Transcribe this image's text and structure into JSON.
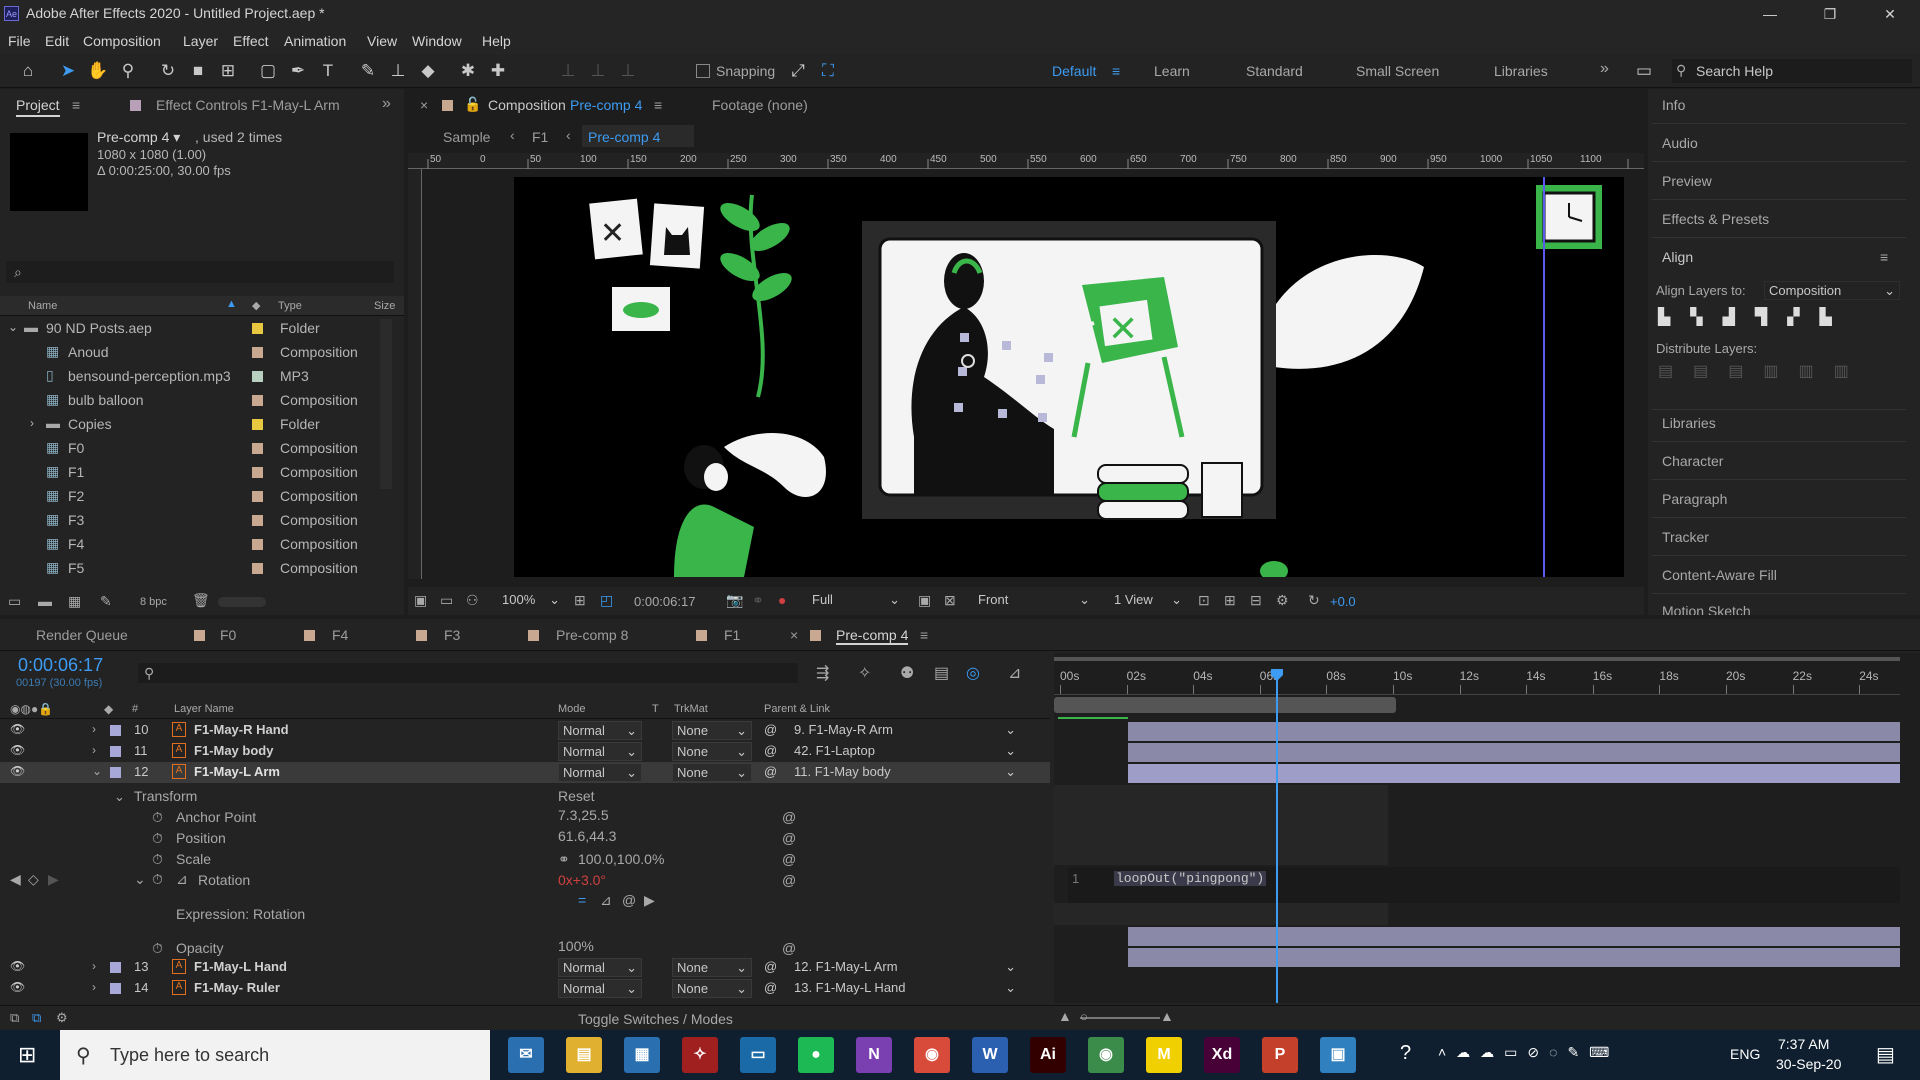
{
  "window": {
    "title": "Adobe After Effects 2020 - Untitled Project.aep *",
    "logo": "Ae",
    "min": "—",
    "max": "❐",
    "close": "✕"
  },
  "menu": [
    "File",
    "Edit",
    "Composition",
    "Layer",
    "Effect",
    "Animation",
    "View",
    "Window",
    "Help"
  ],
  "toolbar": {
    "snapping": "Snapping",
    "workspaces": [
      "Default",
      "Learn",
      "Standard",
      "Small Screen",
      "Libraries"
    ],
    "more": "»",
    "search_placeholder": "Search Help"
  },
  "project_panel": {
    "tab": "Project",
    "tab2": "Effect Controls F1-May-L Arm",
    "comp_name": "Pre-comp 4 ▾",
    "used": ", used 2 times",
    "dims": "1080 x 1080 (1.00)",
    "duration": "Δ 0:00:25:00, 30.00 fps",
    "search_placeholder": "⌕",
    "columns": [
      "Name",
      "Type",
      "Size"
    ],
    "items": [
      {
        "name": "90 ND Posts.aep",
        "type": "Folder",
        "color": "#e8c840",
        "icon": "folder"
      },
      {
        "name": "Anoud",
        "type": "Composition",
        "color": "#c8a890",
        "icon": "comp"
      },
      {
        "name": "bensound-perception.mp3",
        "type": "MP3",
        "color": "#b8d0c0",
        "icon": "file"
      },
      {
        "name": "bulb balloon",
        "type": "Composition",
        "color": "#c8a890",
        "icon": "comp"
      },
      {
        "name": "Copies",
        "type": "Folder",
        "color": "#e8c840",
        "icon": "folder"
      },
      {
        "name": "F0",
        "type": "Composition",
        "color": "#c8a890",
        "icon": "comp"
      },
      {
        "name": "F1",
        "type": "Composition",
        "color": "#c8a890",
        "icon": "comp"
      },
      {
        "name": "F2",
        "type": "Composition",
        "color": "#c8a890",
        "icon": "comp"
      },
      {
        "name": "F3",
        "type": "Composition",
        "color": "#c8a890",
        "icon": "comp"
      },
      {
        "name": "F4",
        "type": "Composition",
        "color": "#c8a890",
        "icon": "comp"
      },
      {
        "name": "F5",
        "type": "Composition",
        "color": "#c8a890",
        "icon": "comp"
      }
    ],
    "bpc": "8 bpc"
  },
  "comp_panel": {
    "tab": "Composition",
    "tab_name": "Pre-comp 4",
    "footage": "Footage (none)",
    "breadcrumbs": [
      "Sample",
      "F1",
      "Pre-comp 4"
    ],
    "ruler": [
      "50",
      "0",
      "50",
      "100",
      "150",
      "200",
      "250",
      "300",
      "350",
      "400",
      "450",
      "500",
      "550",
      "600",
      "650",
      "700",
      "750",
      "800",
      "850",
      "900",
      "950",
      "1000",
      "1050",
      "1100"
    ],
    "zoom": "100%",
    "time": "0:00:06:17",
    "resolution": "Full",
    "view": "Front",
    "views": "1 View",
    "exposure": "+0.0"
  },
  "right_panel": {
    "items": [
      "Info",
      "Audio",
      "Preview",
      "Effects & Presets",
      "Align"
    ],
    "align_to_label": "Align Layers to:",
    "align_to_value": "Composition",
    "distribute": "Distribute Layers:",
    "items2": [
      "Libraries",
      "Character",
      "Paragraph",
      "Tracker",
      "Content-Aware Fill",
      "Motion Sketch"
    ]
  },
  "timeline": {
    "tabs": [
      "Render Queue",
      "F0",
      "F4",
      "F3",
      "Pre-comp 8",
      "F1",
      "Pre-comp 4"
    ],
    "tab_colors": [
      "",
      "#c8a890",
      "#c8a890",
      "#c8a890",
      "#c8a890",
      "#c8a890",
      "#c8a890"
    ],
    "time": "0:00:06:17",
    "frames": "00197 (30.00 fps)",
    "columns": {
      "num": "#",
      "layer": "Layer Name",
      "mode": "Mode",
      "t": "T",
      "trk": "TrkMat",
      "parent": "Parent & Link"
    },
    "layers": [
      {
        "num": "10",
        "name": "F1-May-R Hand",
        "mode": "Normal",
        "trk": "None",
        "parent": "9. F1-May-R Arm"
      },
      {
        "num": "11",
        "name": "F1-May body",
        "mode": "Normal",
        "trk": "None",
        "parent": "42. F1-Laptop"
      },
      {
        "num": "12",
        "name": "F1-May-L Arm",
        "mode": "Normal",
        "trk": "None",
        "parent": "11. F1-May body"
      }
    ],
    "transform": "Transform",
    "reset": "Reset",
    "props": [
      {
        "name": "Anchor Point",
        "value": "7.3,25.5"
      },
      {
        "name": "Position",
        "value": "61.6,44.3"
      },
      {
        "name": "Scale",
        "value": "100.0,100.0%"
      },
      {
        "name": "Rotation",
        "value": "0x+3.0°"
      }
    ],
    "expression_label": "Expression: Rotation",
    "opacity_label": "Opacity",
    "opacity_value": "100%",
    "layers2": [
      {
        "num": "13",
        "name": "F1-May-L Hand",
        "mode": "Normal",
        "trk": "None",
        "parent": "12. F1-May-L Arm"
      },
      {
        "num": "14",
        "name": "F1-May- Ruler",
        "mode": "Normal",
        "trk": "None",
        "parent": "13. F1-May-L Hand"
      }
    ],
    "ruler": [
      "00s",
      "02s",
      "04s",
      "06s",
      "08s",
      "10s",
      "12s",
      "14s",
      "16s",
      "18s",
      "20s",
      "22s",
      "24s"
    ],
    "expr_line": "1",
    "expression": "loopOut(\"pingpong\")",
    "toggle": "Toggle Switches / Modes"
  },
  "taskbar": {
    "search": "Type here to search",
    "time": "7:37 AM",
    "date": "30-Sep-20",
    "lang": "ENG",
    "apps": [
      {
        "name": "mail",
        "glyph": "✉",
        "color": "#2a6fb0"
      },
      {
        "name": "explorer",
        "glyph": "▤",
        "color": "#e0b030"
      },
      {
        "name": "calculator",
        "glyph": "▦",
        "color": "#2a70b0"
      },
      {
        "name": "app-red",
        "glyph": "✧",
        "color": "#a02020"
      },
      {
        "name": "screen",
        "glyph": "▭",
        "color": "#1b6aa8"
      },
      {
        "name": "spotify",
        "glyph": "●",
        "color": "#1db954"
      },
      {
        "name": "onenote",
        "glyph": "N",
        "color": "#7a3fb0"
      },
      {
        "name": "chrome",
        "glyph": "◉",
        "color": "#d84b3b"
      },
      {
        "name": "word",
        "glyph": "W",
        "color": "#2b5fb0"
      },
      {
        "name": "illustrator",
        "glyph": "Ai",
        "color": "#330000"
      },
      {
        "name": "chrome2",
        "glyph": "◉",
        "color": "#3b8b4b"
      },
      {
        "name": "miro",
        "glyph": "M",
        "color": "#f0d000"
      },
      {
        "name": "xd",
        "glyph": "Xd",
        "color": "#470137"
      },
      {
        "name": "powerpoint",
        "glyph": "P",
        "color": "#c4402a"
      },
      {
        "name": "active-app",
        "glyph": "▣",
        "color": "#3080c0"
      }
    ]
  }
}
